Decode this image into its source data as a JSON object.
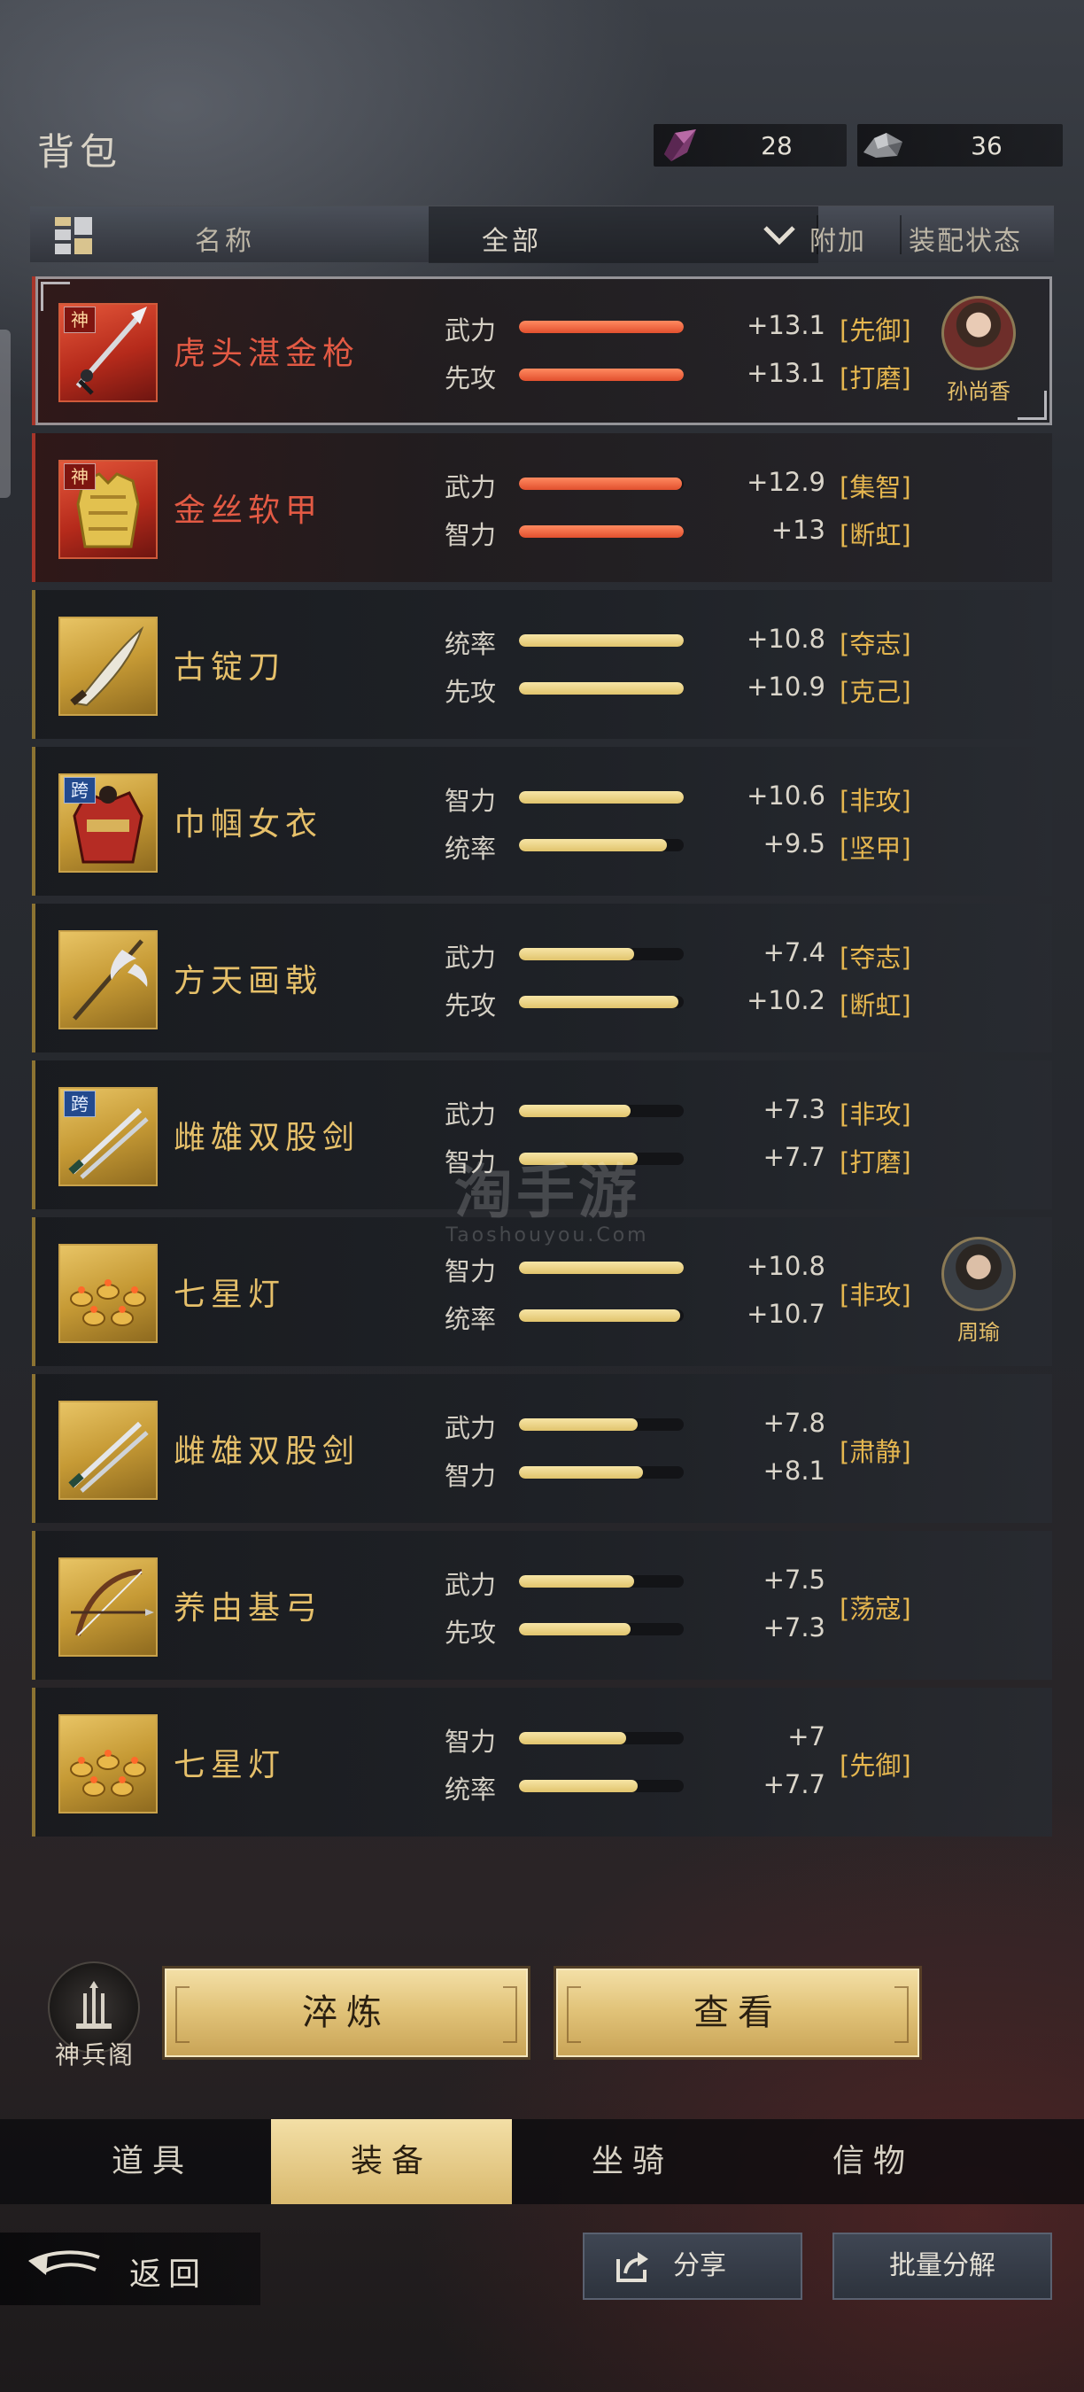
{
  "header": {
    "title": "背包",
    "currencies": [
      {
        "icon": "crystal-icon",
        "value": "28"
      },
      {
        "icon": "ore-icon",
        "value": "36"
      }
    ]
  },
  "table_header": {
    "name": "名称",
    "filter": "全部",
    "extra": "附加",
    "status": "装配状态"
  },
  "items": [
    {
      "name": "虎头湛金枪",
      "tag": "神",
      "rarity": "red",
      "stats": [
        {
          "label": "武力",
          "value": "+13.1",
          "fill": 1.0
        },
        {
          "label": "先攻",
          "value": "+13.1",
          "fill": 1.0
        }
      ],
      "extras": [
        "[先御]",
        "[打磨]"
      ],
      "hero": "孙尚香"
    },
    {
      "name": "金丝软甲",
      "tag": "神",
      "rarity": "red",
      "stats": [
        {
          "label": "武力",
          "value": "+12.9",
          "fill": 0.99
        },
        {
          "label": "智力",
          "value": "+13",
          "fill": 1.0
        }
      ],
      "extras": [
        "[集智]",
        "[断虹]"
      ],
      "hero": ""
    },
    {
      "name": "古锭刀",
      "tag": "",
      "rarity": "gold",
      "stats": [
        {
          "label": "统率",
          "value": "+10.8",
          "fill": 1.0
        },
        {
          "label": "先攻",
          "value": "+10.9",
          "fill": 1.0
        }
      ],
      "extras": [
        "[夺志]",
        "[克己]"
      ],
      "hero": ""
    },
    {
      "name": "巾帼女衣",
      "tag": "跨",
      "rarity": "gold",
      "stats": [
        {
          "label": "智力",
          "value": "+10.6",
          "fill": 1.0
        },
        {
          "label": "统率",
          "value": "+9.5",
          "fill": 0.9
        }
      ],
      "extras": [
        "[非攻]",
        "[坚甲]"
      ],
      "hero": ""
    },
    {
      "name": "方天画戟",
      "tag": "",
      "rarity": "gold",
      "stats": [
        {
          "label": "武力",
          "value": "+7.4",
          "fill": 0.7
        },
        {
          "label": "先攻",
          "value": "+10.2",
          "fill": 0.97
        }
      ],
      "extras": [
        "[夺志]",
        "[断虹]"
      ],
      "hero": ""
    },
    {
      "name": "雌雄双股剑",
      "tag": "跨",
      "rarity": "gold",
      "stats": [
        {
          "label": "武力",
          "value": "+7.3",
          "fill": 0.68
        },
        {
          "label": "智力",
          "value": "+7.7",
          "fill": 0.72
        }
      ],
      "extras": [
        "[非攻]",
        "[打磨]"
      ],
      "hero": ""
    },
    {
      "name": "七星灯",
      "tag": "",
      "rarity": "gold",
      "stats": [
        {
          "label": "智力",
          "value": "+10.8",
          "fill": 1.0
        },
        {
          "label": "统率",
          "value": "+10.7",
          "fill": 0.98
        }
      ],
      "extras": [
        "[非攻]"
      ],
      "hero": "周瑜"
    },
    {
      "name": "雌雄双股剑",
      "tag": "",
      "rarity": "gold",
      "stats": [
        {
          "label": "武力",
          "value": "+7.8",
          "fill": 0.72
        },
        {
          "label": "智力",
          "value": "+8.1",
          "fill": 0.75
        }
      ],
      "extras": [
        "[肃静]"
      ],
      "hero": ""
    },
    {
      "name": "养由基弓",
      "tag": "",
      "rarity": "gold",
      "stats": [
        {
          "label": "武力",
          "value": "+7.5",
          "fill": 0.7
        },
        {
          "label": "先攻",
          "value": "+7.3",
          "fill": 0.68
        }
      ],
      "extras": [
        "[荡寇]"
      ],
      "hero": ""
    },
    {
      "name": "七星灯",
      "tag": "",
      "rarity": "gold",
      "stats": [
        {
          "label": "智力",
          "value": "+7",
          "fill": 0.65
        },
        {
          "label": "统率",
          "value": "+7.7",
          "fill": 0.72
        }
      ],
      "extras": [
        "[先御]"
      ],
      "hero": ""
    }
  ],
  "watermark": {
    "brand": "淘手游",
    "url": "Taoshouyou.Com"
  },
  "actions": {
    "forge_label": "神兵阁",
    "refine": "淬炼",
    "view": "查看"
  },
  "tabs": [
    "道具",
    "装备",
    "坐骑",
    "信物"
  ],
  "active_tab": 1,
  "footer": {
    "back": "返回",
    "share": "分享",
    "batch": "批量分解"
  }
}
